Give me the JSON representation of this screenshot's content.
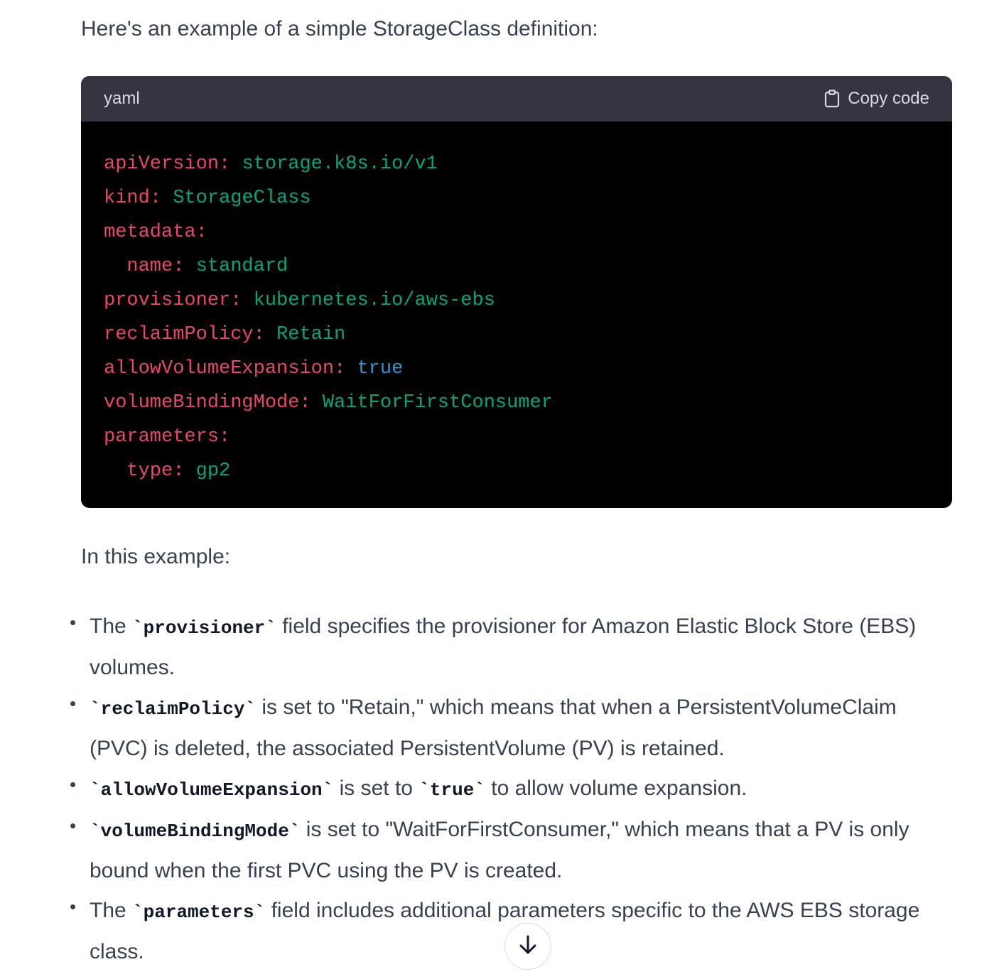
{
  "intro": "Here's an example of a simple StorageClass definition:",
  "code": {
    "language": "yaml",
    "copy_label": "Copy code",
    "copy_icon": "clipboard-icon",
    "lines": [
      {
        "indent": "",
        "key": "apiVersion",
        "value": "storage.k8s.io/v1",
        "value_type": "string"
      },
      {
        "indent": "",
        "key": "kind",
        "value": "StorageClass",
        "value_type": "string"
      },
      {
        "indent": "",
        "key": "metadata",
        "value": "",
        "value_type": "none"
      },
      {
        "indent": "  ",
        "key": "name",
        "value": "standard",
        "value_type": "string"
      },
      {
        "indent": "",
        "key": "provisioner",
        "value": "kubernetes.io/aws-ebs",
        "value_type": "string"
      },
      {
        "indent": "",
        "key": "reclaimPolicy",
        "value": "Retain",
        "value_type": "string"
      },
      {
        "indent": "",
        "key": "allowVolumeExpansion",
        "value": "true",
        "value_type": "boolean"
      },
      {
        "indent": "",
        "key": "volumeBindingMode",
        "value": "WaitForFirstConsumer",
        "value_type": "string"
      },
      {
        "indent": "",
        "key": "parameters",
        "value": "",
        "value_type": "none"
      },
      {
        "indent": "  ",
        "key": "type",
        "value": "gp2",
        "value_type": "string"
      }
    ],
    "colors": {
      "key": "#e9466a",
      "string": "#00a67d",
      "boolean": "#2e95d3",
      "header_bg": "#343541",
      "body_bg": "#000000"
    }
  },
  "paragraph": "In this example:",
  "bullets": [
    {
      "pre": "The ",
      "code": "`provisioner`",
      "post": " field specifies the provisioner for Amazon Elastic Block Store (EBS) volumes."
    },
    {
      "pre": "",
      "code": "`reclaimPolicy`",
      "post": " is set to \"Retain,\" which means that when a PersistentVolumeClaim (PVC) is deleted, the associated PersistentVolume (PV) is retained."
    },
    {
      "pre": "",
      "code": "`allowVolumeExpansion`",
      "post": " is set to ",
      "code2": "`true`",
      "post2": " to allow volume expansion."
    },
    {
      "pre": "",
      "code": "`volumeBindingMode`",
      "post": " is set to \"WaitForFirstConsumer,\" which means that a PV is only bound when the first PVC using the PV is created."
    },
    {
      "pre": "The ",
      "code": "`parameters`",
      "post": " field includes additional parameters specific to the AWS EBS storage class."
    }
  ],
  "scroll_button": {
    "icon": "arrow-down-icon"
  }
}
